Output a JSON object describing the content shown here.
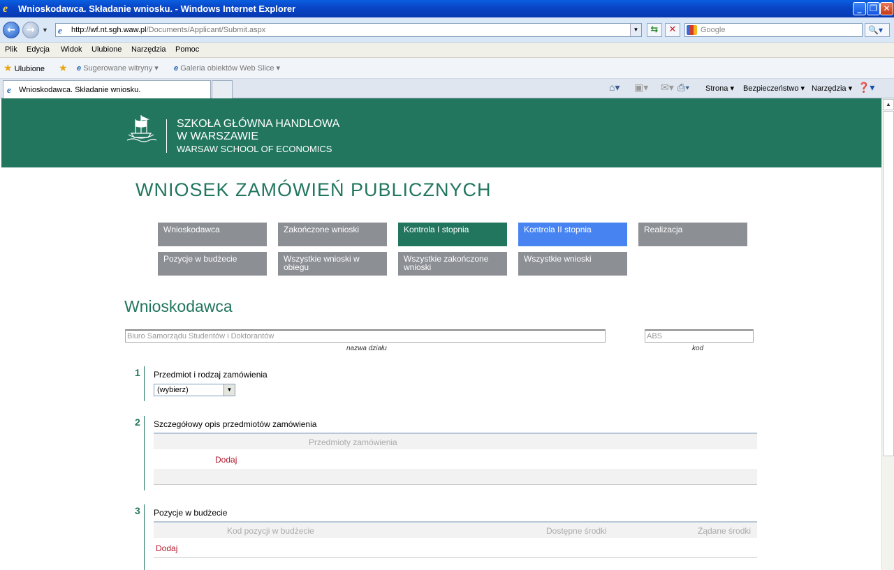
{
  "window": {
    "title": "Wnioskodawca. Składanie wniosku. - Windows Internet Explorer"
  },
  "address": {
    "url_host": "http://wf.nt.sgh.waw.pl",
    "url_path": "/Documents/Applicant/Submit.aspx",
    "search_placeholder": "Google"
  },
  "menu": [
    "Plik",
    "Edycja",
    "Widok",
    "Ulubione",
    "Narzędzia",
    "Pomoc"
  ],
  "favorites": {
    "label": "Ulubione",
    "suggested": "Sugerowane witryny",
    "gallery": "Galeria obiektów Web Slice"
  },
  "tab": {
    "title": "Wnioskodawca. Składanie wniosku."
  },
  "commands": {
    "page": "Strona",
    "security": "Bezpieczeństwo",
    "tools": "Narzędzia"
  },
  "banner": {
    "line1": "SZKOŁA GŁÓWNA HANDLOWA",
    "line2": "W WARSZAWIE",
    "line3": "WARSAW SCHOOL OF ECONOMICS"
  },
  "page_title": "WNIOSEK ZAMÓWIEŃ PUBLICZNYCH",
  "nav": [
    {
      "label": "Wnioskodawca"
    },
    {
      "label": "Zakończone wnioski"
    },
    {
      "label": "Kontrola I stopnia"
    },
    {
      "label": "Kontrola II stopnia"
    },
    {
      "label": "Realizacja"
    },
    {
      "label": "Pozycje w budżecie"
    },
    {
      "label": "Wszystkie wnioski w obiegu"
    },
    {
      "label": "Wszystkie zakończone wnioski"
    },
    {
      "label": "Wszystkie wnioski"
    }
  ],
  "section_title": "Wnioskodawca",
  "department": {
    "name": "Biuro Samorządu Studentów i Doktorantów",
    "name_caption": "nazwa działu",
    "code": "ABS",
    "code_caption": "kod"
  },
  "steps": [
    {
      "number": "1",
      "label": "Przedmiot i rodzaj zamówienia",
      "select_value": "(wybierz)"
    },
    {
      "number": "2",
      "label": "Szczegółowy opis przedmiotów zamówienia",
      "table_header": "Przedmioty zamówienia",
      "add_label": "Dodaj"
    },
    {
      "number": "3",
      "label": "Pozycje w budżecie",
      "col1": "Kod pozycji w budżecie",
      "col2": "Dostępne środki",
      "col3": "Żądane środki",
      "add_label": "Dodaj"
    }
  ]
}
